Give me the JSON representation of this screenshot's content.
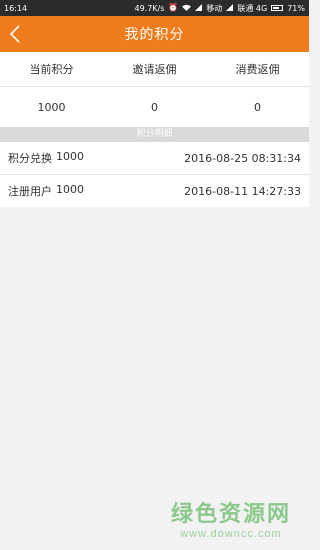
{
  "statusbar": {
    "time": "16:14",
    "speed": "49.7K/s",
    "carrier1": "移动",
    "carrier2": "联通 4G",
    "battery": "71%"
  },
  "header": {
    "title": "我的积分"
  },
  "stats": {
    "labels": [
      "当前积分",
      "邀请返佣",
      "消费返佣"
    ],
    "values": [
      "1000",
      "0",
      "0"
    ]
  },
  "details": {
    "section_title": "积分明细",
    "items": [
      {
        "type": "积分兑换",
        "amount": "1000",
        "time": "2016-08-25 08:31:34"
      },
      {
        "type": "注册用户",
        "amount": "1000",
        "time": "2016-08-11 14:27:33"
      }
    ]
  },
  "watermark": {
    "cn": "绿色资源网",
    "url": "www.downcc.com"
  }
}
